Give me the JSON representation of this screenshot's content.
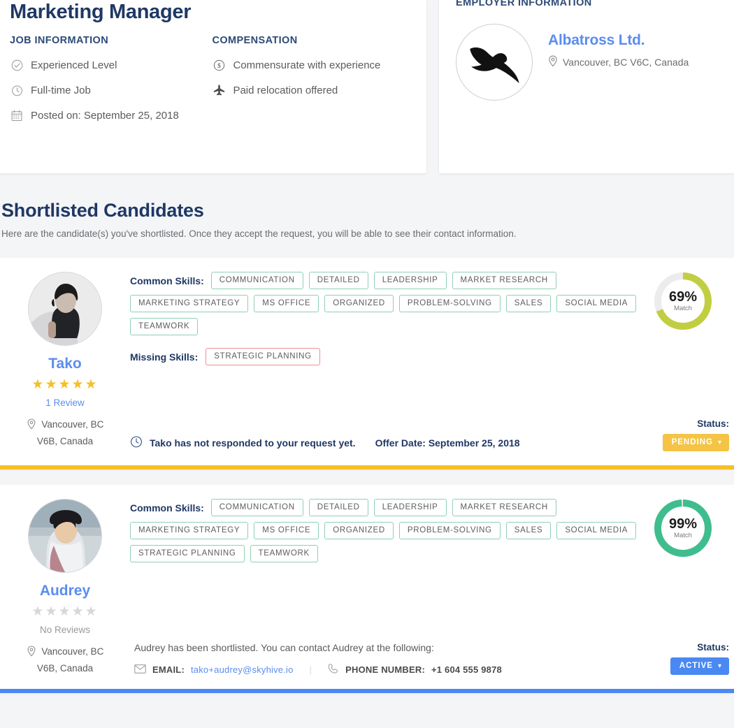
{
  "job": {
    "title": "Marketing Manager",
    "sections": {
      "job_information": {
        "heading": "JOB INFORMATION",
        "items": [
          {
            "icon": "check-circle-icon",
            "text": "Experienced Level"
          },
          {
            "icon": "clock-icon",
            "text": "Full-time Job"
          },
          {
            "icon": "calendar-icon",
            "text": "Posted on: September 25, 2018"
          }
        ]
      },
      "compensation": {
        "heading": "COMPENSATION",
        "items": [
          {
            "icon": "dollar-circle-icon",
            "text": "Commensurate with experience"
          },
          {
            "icon": "airplane-icon",
            "text": "Paid relocation offered"
          }
        ]
      }
    }
  },
  "employer": {
    "heading": "EMPLOYER INFORMATION",
    "logo_icon": "albatross-bird-logo",
    "name": "Albatross Ltd.",
    "location_icon": "map-pin-icon",
    "location": "Vancouver, BC V6C, Canada"
  },
  "shortlist": {
    "title": "Shortlisted Candidates",
    "subtitle": "Here are the candidate(s) you've shortlisted. Once they accept the request, you will be able to see their contact information.",
    "skills_label": "Common Skills:",
    "missing_label": "Missing Skills:",
    "status_caption": "Status:"
  },
  "candidates": [
    {
      "name": "Tako",
      "avatar": "photo-woman-dark-hair",
      "stars_filled": 5,
      "review_text": "1 Review",
      "has_reviews": true,
      "location_icon": "map-pin-icon",
      "location_line1": "Vancouver, BC",
      "location_line2": "V6B, Canada",
      "common_skills": [
        "COMMUNICATION",
        "DETAILED",
        "LEADERSHIP",
        "MARKET RESEARCH",
        "MARKETING STRATEGY",
        "MS OFFICE",
        "ORGANIZED",
        "PROBLEM-SOLVING",
        "SALES",
        "SOCIAL MEDIA",
        "TEAMWORK"
      ],
      "missing_skills": [
        "STRATEGIC PLANNING"
      ],
      "match_percent": "69%",
      "match_label": "Match",
      "match_value": 69,
      "ring_color": "#c2ce41",
      "state": "pending",
      "status_icon": "clock-icon",
      "status_note": "Tako has not responded to your request yet.",
      "offer_date": "Offer Date: September 25, 2018",
      "status_badge": "PENDING",
      "accent_color": "#f5bf2a"
    },
    {
      "name": "Audrey",
      "avatar": "photo-woman-beanie-snow",
      "stars_filled": 0,
      "review_text": "No Reviews",
      "has_reviews": false,
      "location_icon": "map-pin-icon",
      "location_line1": "Vancouver, BC",
      "location_line2": "V6B, Canada",
      "common_skills": [
        "COMMUNICATION",
        "DETAILED",
        "LEADERSHIP",
        "MARKET RESEARCH",
        "MARKETING STRATEGY",
        "MS OFFICE",
        "ORGANIZED",
        "PROBLEM-SOLVING",
        "SALES",
        "SOCIAL MEDIA",
        "STRATEGIC PLANNING",
        "TEAMWORK"
      ],
      "missing_skills": [],
      "match_percent": "99%",
      "match_label": "Match",
      "match_value": 99,
      "ring_color": "#3fbd8e",
      "state": "active",
      "contact_lead": "Audrey has been shortlisted. You can contact Audrey at the following:",
      "email_icon": "envelope-icon",
      "email_label": "EMAIL:",
      "email_value": "tako+audrey@skyhive.io",
      "phone_icon": "phone-icon",
      "phone_label": "PHONE NUMBER:",
      "phone_value": "+1 604 555 9878",
      "status_badge": "ACTIVE",
      "accent_color": "#4a89f3"
    }
  ]
}
